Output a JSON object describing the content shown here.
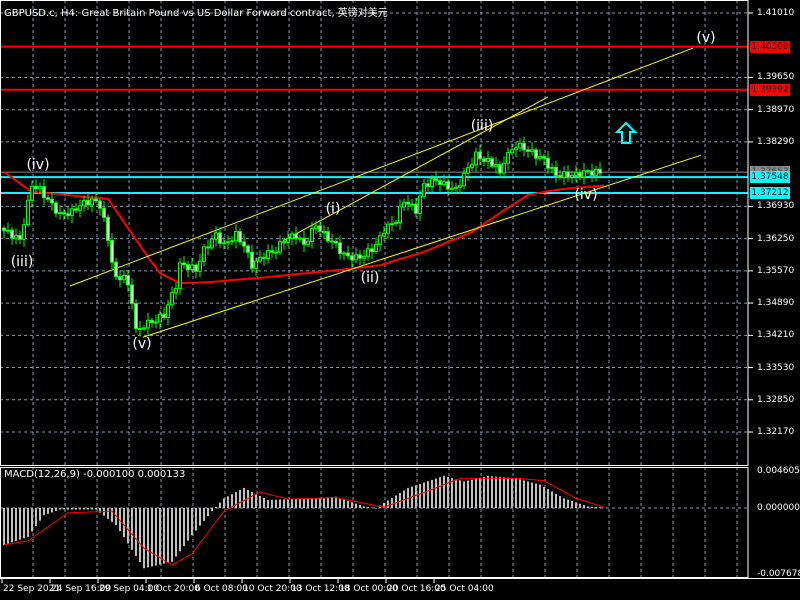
{
  "header": {
    "title": "GBPUSD.c, H4:  Great Britain Pound vs US Dollar Forward contract, 英镑对美元"
  },
  "macd": {
    "title": "MACD(12,26,9) -0.000100 0.000133",
    "ticks": [
      "0.004605",
      "0.000000",
      "-0.007678"
    ]
  },
  "colors": {
    "background": "#000000",
    "bull": "#00ff00",
    "ma": "#ff0000",
    "trend": "#ffff00",
    "level_red": "#ff0000",
    "level_cyan": "#00ffff",
    "grid": "#8899aa",
    "histogram": "#c0c0c0"
  },
  "chart_data": {
    "type": "candlestick",
    "symbol": "GBPUSD.c",
    "timeframe": "H4",
    "price_axis": {
      "range": [
        1.319,
        1.413
      ],
      "ticks": [
        "1.41010",
        "1.39650",
        "1.38970",
        "1.38290",
        "1.36930",
        "1.36250",
        "1.35570",
        "1.34890",
        "1.34210",
        "1.33530",
        "1.32850",
        "1.32170"
      ]
    },
    "time_axis": {
      "ticks": [
        {
          "label": "22 Sep 2021",
          "bar": 0
        },
        {
          "label": "24 Sep 16:00",
          "bar": 12
        },
        {
          "label": "29 Sep 04:00",
          "bar": 24
        },
        {
          "label": "1 Oct 20:00",
          "bar": 36
        },
        {
          "label": "6 Oct 08:00",
          "bar": 48
        },
        {
          "label": "10 Oct 20:00",
          "bar": 60
        },
        {
          "label": "13 Oct 12:00",
          "bar": 72
        },
        {
          "label": "18 Oct 00:00",
          "bar": 84
        },
        {
          "label": "20 Oct 16:00",
          "bar": 96
        },
        {
          "label": "25 Oct 04:00",
          "bar": 108
        }
      ]
    },
    "close_path": [
      [
        0,
        1.3647
      ],
      [
        3,
        1.3633
      ],
      [
        5,
        1.3622
      ],
      [
        8,
        1.3738
      ],
      [
        10,
        1.3728
      ],
      [
        13,
        1.3696
      ],
      [
        15,
        1.3675
      ],
      [
        18,
        1.3681
      ],
      [
        20,
        1.3696
      ],
      [
        23,
        1.3706
      ],
      [
        25,
        1.3696
      ],
      [
        26,
        1.3664
      ],
      [
        28,
        1.358
      ],
      [
        29,
        1.3538
      ],
      [
        31,
        1.3548
      ],
      [
        33,
        1.3495
      ],
      [
        34,
        1.3432
      ],
      [
        35,
        1.3432
      ],
      [
        36,
        1.3443
      ],
      [
        39,
        1.3453
      ],
      [
        41,
        1.3464
      ],
      [
        44,
        1.3527
      ],
      [
        45,
        1.3569
      ],
      [
        46,
        1.3569
      ],
      [
        49,
        1.3559
      ],
      [
        51,
        1.3601
      ],
      [
        54,
        1.3633
      ],
      [
        56,
        1.3611
      ],
      [
        59,
        1.3633
      ],
      [
        61,
        1.3611
      ],
      [
        63,
        1.3569
      ],
      [
        64,
        1.3575
      ],
      [
        66,
        1.359
      ],
      [
        69,
        1.3601
      ],
      [
        71,
        1.3622
      ],
      [
        74,
        1.3633
      ],
      [
        76,
        1.3611
      ],
      [
        79,
        1.3654
      ],
      [
        81,
        1.3633
      ],
      [
        84,
        1.3611
      ],
      [
        86,
        1.359
      ],
      [
        89,
        1.3584
      ],
      [
        91,
        1.359
      ],
      [
        94,
        1.3611
      ],
      [
        96,
        1.3643
      ],
      [
        99,
        1.3664
      ],
      [
        101,
        1.3706
      ],
      [
        104,
        1.3685
      ],
      [
        106,
        1.3738
      ],
      [
        109,
        1.3749
      ],
      [
        111,
        1.3738
      ],
      [
        114,
        1.3728
      ],
      [
        116,
        1.3759
      ],
      [
        119,
        1.3801
      ],
      [
        121,
        1.3791
      ],
      [
        124,
        1.378
      ],
      [
        125,
        1.3759
      ],
      [
        126,
        1.3791
      ],
      [
        128,
        1.3812
      ],
      [
        129,
        1.3822
      ],
      [
        131,
        1.3816
      ],
      [
        134,
        1.3801
      ],
      [
        136,
        1.3791
      ],
      [
        139,
        1.3759
      ],
      [
        141,
        1.3759
      ],
      [
        144,
        1.3759
      ],
      [
        146,
        1.3765
      ],
      [
        149,
        1.3765
      ]
    ],
    "moving_average": [
      [
        0,
        1.3766
      ],
      [
        7,
        1.3723
      ],
      [
        14,
        1.3719
      ],
      [
        20,
        1.3713
      ],
      [
        26,
        1.3709
      ],
      [
        31,
        1.3647
      ],
      [
        36,
        1.3586
      ],
      [
        39,
        1.3552
      ],
      [
        44,
        1.3531
      ],
      [
        51,
        1.3533
      ],
      [
        66,
        1.3544
      ],
      [
        86,
        1.3561
      ],
      [
        94,
        1.3569
      ],
      [
        105,
        1.3597
      ],
      [
        117,
        1.3639
      ],
      [
        125,
        1.3685
      ],
      [
        131,
        1.3717
      ],
      [
        136,
        1.3725
      ],
      [
        141,
        1.3731
      ],
      [
        150,
        1.3737
      ]
    ],
    "trendlines": [
      {
        "from": [
          34.75,
          1.3417
        ],
        "to": [
          174.25,
          1.3801
        ]
      },
      {
        "from": [
          16.5,
          1.3525
        ],
        "to": [
          172.25,
          1.4027
        ]
      },
      {
        "from": [
          69.75,
          1.362
        ],
        "to": [
          136,
          1.3924
        ]
      }
    ],
    "levels": [
      {
        "price": "1.40300",
        "color": "red"
      },
      {
        "price": "1.39392",
        "color": "red"
      },
      {
        "price": "1.37548",
        "color": "cyan"
      },
      {
        "price": "1.37212",
        "color": "cyan"
      },
      {
        "price": "1.37653",
        "color": "gray"
      }
    ],
    "wave_labels": [
      "(iv)",
      "(iii)",
      "(v)",
      "(i)",
      "(ii)",
      "(iii)",
      "(iv)",
      "(v)"
    ],
    "macd_histogram": [
      [
        0,
        -0.0046
      ],
      [
        6,
        -0.0036
      ],
      [
        10,
        -0.0009
      ],
      [
        14,
        -0.0002
      ],
      [
        23,
        -0.0002
      ],
      [
        28,
        -0.0021
      ],
      [
        35,
        -0.0075
      ],
      [
        42,
        -0.0067
      ],
      [
        47,
        -0.0034
      ],
      [
        52,
        -0.0004
      ],
      [
        55,
        0.0012
      ],
      [
        60,
        0.0025
      ],
      [
        66,
        0.001
      ],
      [
        77,
        0.0012
      ],
      [
        83,
        0.0014
      ],
      [
        90,
        0.0002
      ],
      [
        93,
        0.0
      ],
      [
        101,
        0.0025
      ],
      [
        110,
        0.004
      ],
      [
        115,
        0.0033
      ],
      [
        121,
        0.004
      ],
      [
        128,
        0.0037
      ],
      [
        134,
        0.0029
      ],
      [
        140,
        0.0012
      ],
      [
        146,
        0.0002
      ],
      [
        149,
        0.0001
      ]
    ],
    "macd_signal": [
      [
        0,
        -0.0046
      ],
      [
        6,
        -0.0041
      ],
      [
        16,
        -0.0006
      ],
      [
        27,
        -0.0004
      ],
      [
        35,
        -0.005
      ],
      [
        42,
        -0.0071
      ],
      [
        47,
        -0.0057
      ],
      [
        55,
        -0.0004
      ],
      [
        64,
        0.002
      ],
      [
        71,
        0.0011
      ],
      [
        83,
        0.0013
      ],
      [
        95,
        0.0001
      ],
      [
        107,
        0.0023
      ],
      [
        114,
        0.0037
      ],
      [
        128,
        0.0037
      ],
      [
        135,
        0.0034
      ],
      [
        143,
        0.0012
      ],
      [
        150,
        0.0001
      ]
    ],
    "macd_axis": {
      "range": [
        -0.007678,
        0.004605
      ]
    }
  }
}
